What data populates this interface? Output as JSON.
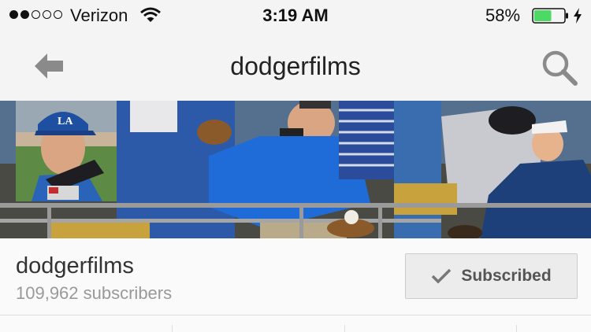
{
  "status_bar": {
    "signal_bars": 2,
    "carrier": "Verizon",
    "time": "3:19 AM",
    "battery": "58%",
    "battery_level": 0.58,
    "battery_color": "#4cd964",
    "icons": [
      "wifi-icon",
      "battery-icon",
      "charging-bolt-icon"
    ]
  },
  "nav": {
    "title": "dodgerfilms",
    "back_icon": "back-arrow-icon",
    "search_icon": "search-icon"
  },
  "channel": {
    "name": "dodgerfilms",
    "subscribers": "109,962 subscribers",
    "subscribe_button": {
      "label": "Subscribed",
      "icon": "checkmark-icon"
    }
  },
  "colors": {
    "background": "#fafafa",
    "bar_background": "#f4f4f4",
    "muted_text": "#999999"
  }
}
